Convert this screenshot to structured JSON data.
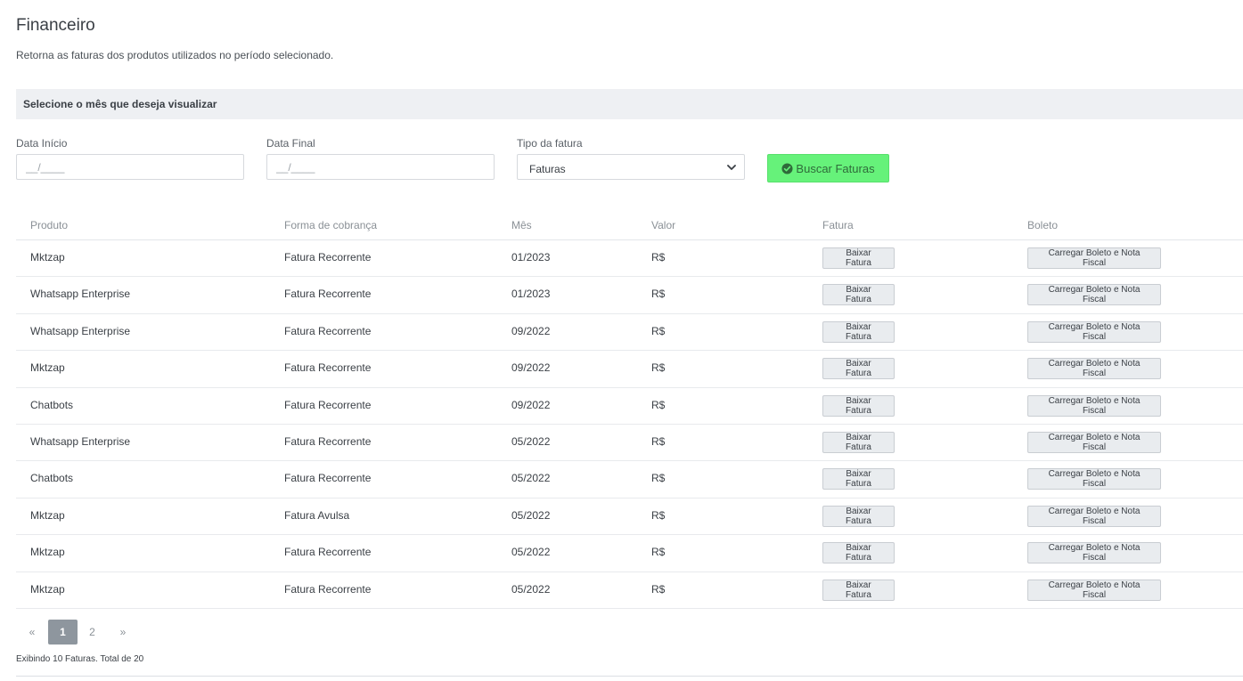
{
  "page": {
    "title": "Financeiro",
    "subtitle": "Retorna as faturas dos produtos utilizados no período selecionado."
  },
  "filters": {
    "header": "Selecione o mês que deseja visualizar",
    "start_label": "Data Início",
    "start_placeholder": "__/____",
    "end_label": "Data Final",
    "end_placeholder": "__/____",
    "type_label": "Tipo da fatura",
    "type_value": "Faturas",
    "search_button": "Buscar Faturas",
    "search_icon": "check-circle-icon",
    "accent_color": "#66f27a"
  },
  "table": {
    "headers": {
      "produto": "Produto",
      "forma": "Forma de cobrança",
      "mes": "Mês",
      "valor": "Valor",
      "fatura": "Fatura",
      "boleto": "Boleto"
    },
    "rows": [
      {
        "produto": "Mktzap",
        "forma": "Fatura Recorrente",
        "mes": "01/2023",
        "valor": "R$",
        "fatura_btn": "Baixar Fatura",
        "boleto_btn": "Carregar Boleto e Nota Fiscal"
      },
      {
        "produto": "Whatsapp Enterprise",
        "forma": "Fatura Recorrente",
        "mes": "01/2023",
        "valor": "R$",
        "fatura_btn": "Baixar Fatura",
        "boleto_btn": "Carregar Boleto e Nota Fiscal"
      },
      {
        "produto": "Whatsapp Enterprise",
        "forma": "Fatura Recorrente",
        "mes": "09/2022",
        "valor": "R$",
        "fatura_btn": "Baixar Fatura",
        "boleto_btn": "Carregar Boleto e Nota Fiscal"
      },
      {
        "produto": "Mktzap",
        "forma": "Fatura Recorrente",
        "mes": "09/2022",
        "valor": "R$",
        "fatura_btn": "Baixar Fatura",
        "boleto_btn": "Carregar Boleto e Nota Fiscal"
      },
      {
        "produto": "Chatbots",
        "forma": "Fatura Recorrente",
        "mes": "09/2022",
        "valor": "R$",
        "fatura_btn": "Baixar Fatura",
        "boleto_btn": "Carregar Boleto e Nota Fiscal"
      },
      {
        "produto": "Whatsapp Enterprise",
        "forma": "Fatura Recorrente",
        "mes": "05/2022",
        "valor": "R$",
        "fatura_btn": "Baixar Fatura",
        "boleto_btn": "Carregar Boleto e Nota Fiscal"
      },
      {
        "produto": "Chatbots",
        "forma": "Fatura Recorrente",
        "mes": "05/2022",
        "valor": "R$",
        "fatura_btn": "Baixar Fatura",
        "boleto_btn": "Carregar Boleto e Nota Fiscal"
      },
      {
        "produto": "Mktzap",
        "forma": "Fatura Avulsa",
        "mes": "05/2022",
        "valor": "R$",
        "fatura_btn": "Baixar Fatura",
        "boleto_btn": "Carregar Boleto e Nota Fiscal"
      },
      {
        "produto": "Mktzap",
        "forma": "Fatura Recorrente",
        "mes": "05/2022",
        "valor": "R$",
        "fatura_btn": "Baixar Fatura",
        "boleto_btn": "Carregar Boleto e Nota Fiscal"
      },
      {
        "produto": "Mktzap",
        "forma": "Fatura Recorrente",
        "mes": "05/2022",
        "valor": "R$",
        "fatura_btn": "Baixar Fatura",
        "boleto_btn": "Carregar Boleto e Nota Fiscal"
      }
    ]
  },
  "pagination": {
    "prev": "«",
    "pages": [
      "1",
      "2"
    ],
    "current": "1",
    "next": "»"
  },
  "footer": {
    "summary": "Exibindo 10 Faturas. Total de 20"
  }
}
